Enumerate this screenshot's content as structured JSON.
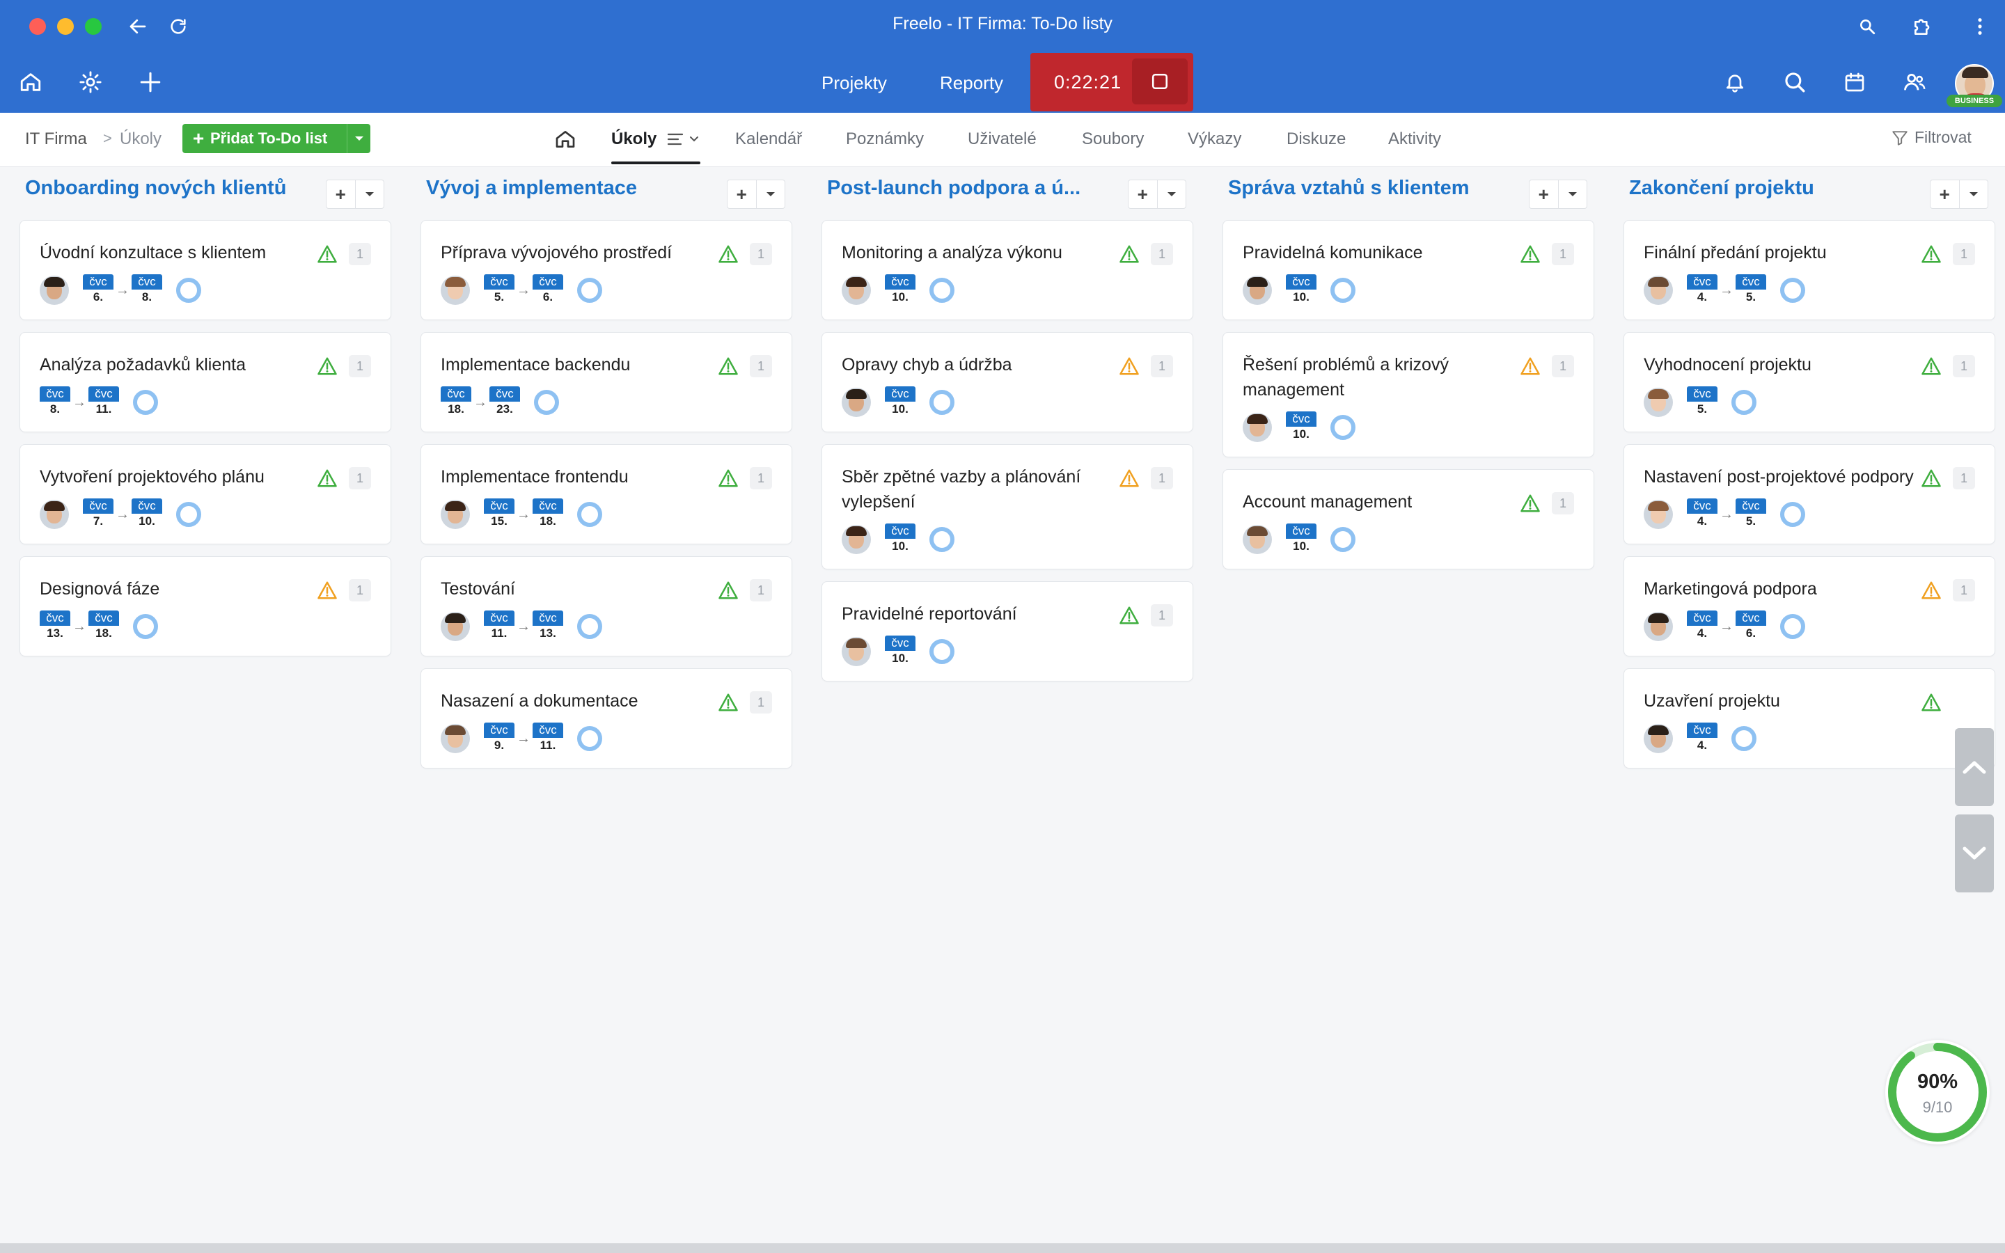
{
  "window": {
    "title": "Freelo - IT Firma: To-Do listy"
  },
  "appbar": {
    "links": [
      "Projekty",
      "Reporty"
    ],
    "timer": "0:22:21",
    "badge": "BUSINESS"
  },
  "breadcrumb": {
    "project": "IT Firma",
    "current": "Úkoly",
    "separator": ">"
  },
  "add_list_button": "Přidat To-Do list",
  "tabs": [
    "Úkoly",
    "Kalendář",
    "Poznámky",
    "Uživatelé",
    "Soubory",
    "Výkazy",
    "Diskuze",
    "Aktivity"
  ],
  "filter_label": "Filtrovat",
  "colors": {
    "brand": "#2f6fd0",
    "column_title": "#1d73c8",
    "add_green": "#3fae3f",
    "timer_red": "#c0272d",
    "warn_green": "#3fae3f",
    "warn_orange": "#f0a020",
    "ring_blue": "#8ec1f2"
  },
  "columns": [
    {
      "title": "Onboarding nových klientů",
      "cards": [
        {
          "title": "Úvodní konzultace s klientem",
          "warn": "green",
          "count": "1",
          "start": {
            "w": "čvc",
            "d": "6."
          },
          "end": {
            "w": "čvc",
            "d": "8."
          },
          "avatar": "male-dark"
        },
        {
          "title": "Analýza požadavků klienta",
          "warn": "green",
          "count": "1",
          "start": {
            "w": "čvc",
            "d": "8."
          },
          "end": {
            "w": "čvc",
            "d": "11."
          },
          "avatar": ""
        },
        {
          "title": "Vytvoření projektového plánu",
          "warn": "green",
          "count": "1",
          "start": {
            "w": "čvc",
            "d": "7."
          },
          "end": {
            "w": "čvc",
            "d": "10."
          },
          "avatar": "female-dark"
        },
        {
          "title": "Designová fáze",
          "warn": "orange",
          "count": "1",
          "start": {
            "w": "čvc",
            "d": "13."
          },
          "end": {
            "w": "čvc",
            "d": "18."
          },
          "avatar": ""
        }
      ]
    },
    {
      "title": "Vývoj a implementace",
      "cards": [
        {
          "title": "Příprava vývojového prostředí",
          "warn": "green",
          "count": "1",
          "start": {
            "w": "čvc",
            "d": "5."
          },
          "end": {
            "w": "čvc",
            "d": "6."
          },
          "avatar": "female-light"
        },
        {
          "title": "Implementace backendu",
          "warn": "green",
          "count": "1",
          "start": {
            "w": "čvc",
            "d": "18."
          },
          "end": {
            "w": "čvc",
            "d": "23."
          },
          "avatar": ""
        },
        {
          "title": "Implementace frontendu",
          "warn": "green",
          "count": "1",
          "start": {
            "w": "čvc",
            "d": "15."
          },
          "end": {
            "w": "čvc",
            "d": "18."
          },
          "avatar": "female-dark"
        },
        {
          "title": "Testování",
          "warn": "green",
          "count": "1",
          "start": {
            "w": "čvc",
            "d": "11."
          },
          "end": {
            "w": "čvc",
            "d": "13."
          },
          "avatar": "male-dark"
        },
        {
          "title": "Nasazení a dokumentace",
          "warn": "green",
          "count": "1",
          "start": {
            "w": "čvc",
            "d": "9."
          },
          "end": {
            "w": "čvc",
            "d": "11."
          },
          "avatar": "male-light"
        }
      ]
    },
    {
      "title": "Post-launch podpora a ú...",
      "cards": [
        {
          "title": "Monitoring a analýza výkonu",
          "warn": "green",
          "count": "1",
          "start": {
            "w": "čvc",
            "d": "10."
          },
          "avatar": "female-dark"
        },
        {
          "title": "Opravy chyb a údržba",
          "warn": "orange",
          "count": "1",
          "start": {
            "w": "čvc",
            "d": "10."
          },
          "avatar": "male-dark"
        },
        {
          "title": "Sběr zpětné vazby a plánování vylepšení",
          "warn": "orange",
          "count": "1",
          "start": {
            "w": "čvc",
            "d": "10."
          },
          "avatar": "female-dark"
        },
        {
          "title": "Pravidelné reportování",
          "warn": "green",
          "count": "1",
          "start": {
            "w": "čvc",
            "d": "10."
          },
          "avatar": "male-light"
        }
      ]
    },
    {
      "title": "Správa vztahů s klientem",
      "cards": [
        {
          "title": "Pravidelná komunikace",
          "warn": "green",
          "count": "1",
          "start": {
            "w": "čvc",
            "d": "10."
          },
          "avatar": "male-dark"
        },
        {
          "title": "Řešení problémů a krizový management",
          "warn": "orange",
          "count": "1",
          "start": {
            "w": "čvc",
            "d": "10."
          },
          "avatar": "female-dark"
        },
        {
          "title": "Account management",
          "warn": "green",
          "count": "1",
          "start": {
            "w": "čvc",
            "d": "10."
          },
          "avatar": "male-light"
        }
      ]
    },
    {
      "title": "Zakončení projektu",
      "cards": [
        {
          "title": "Finální předání projektu",
          "warn": "green",
          "count": "1",
          "start": {
            "w": "čvc",
            "d": "4."
          },
          "end": {
            "w": "čvc",
            "d": "5."
          },
          "avatar": "male-light"
        },
        {
          "title": "Vyhodnocení projektu",
          "warn": "green",
          "count": "1",
          "start": {
            "w": "čvc",
            "d": "5."
          },
          "avatar": "female-light"
        },
        {
          "title": "Nastavení post-projektové podpory",
          "warn": "green",
          "count": "1",
          "start": {
            "w": "čvc",
            "d": "4."
          },
          "end": {
            "w": "čvc",
            "d": "5."
          },
          "avatar": "female-light"
        },
        {
          "title": "Marketingová podpora",
          "warn": "orange",
          "count": "1",
          "start": {
            "w": "čvc",
            "d": "4."
          },
          "end": {
            "w": "čvc",
            "d": "6."
          },
          "avatar": "male-dark"
        },
        {
          "title": "Uzavření projektu",
          "warn": "green",
          "count": "",
          "start": {
            "w": "čvc",
            "d": "4."
          },
          "avatar": "male-dark"
        }
      ]
    }
  ],
  "progress": {
    "percent": "90%",
    "fraction": "9/10",
    "value": 0.9
  }
}
